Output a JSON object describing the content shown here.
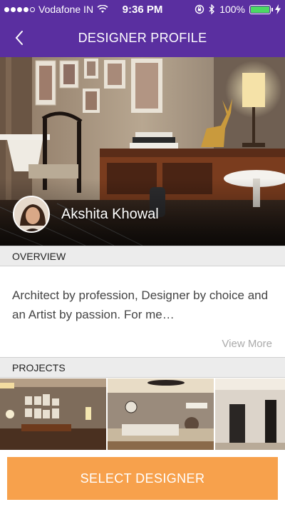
{
  "status_bar": {
    "carrier": "Vodafone IN",
    "time": "9:36 PM",
    "battery": "100%",
    "battery_level": 1.0,
    "icons": [
      "signal-dots-icon",
      "wifi-icon",
      "orientation-lock-icon",
      "bluetooth-icon",
      "battery-icon",
      "charging-icon"
    ]
  },
  "nav": {
    "title": "DESIGNER PROFILE",
    "back_icon": "chevron-left-icon"
  },
  "profile": {
    "name": "Akshita Khowal"
  },
  "overview": {
    "header": "OVERVIEW",
    "text": "Architect by profession, Designer by choice and an Artist by passion.  For me…",
    "view_more": "View More"
  },
  "projects": {
    "header": "PROJECTS",
    "items": [
      {
        "name": "project-1"
      },
      {
        "name": "project-2"
      },
      {
        "name": "project-3"
      }
    ]
  },
  "cta": {
    "label": "SELECT DESIGNER",
    "color": "#f7a14c"
  },
  "colors": {
    "brand": "#5a2fa0",
    "accent": "#f7a14c"
  }
}
